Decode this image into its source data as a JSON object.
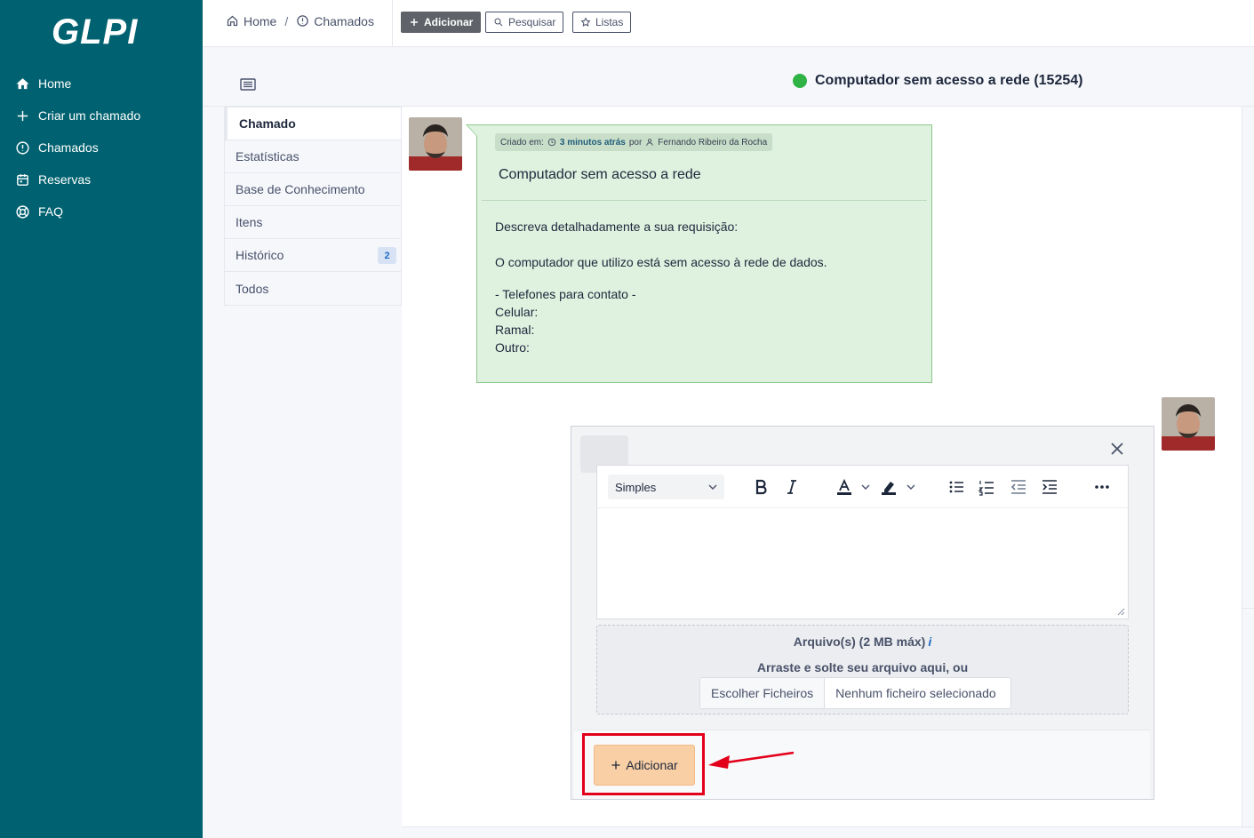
{
  "app": {
    "logo": "GLPI"
  },
  "sidebar": {
    "items": [
      {
        "label": "Home",
        "icon": "home-icon"
      },
      {
        "label": "Criar um chamado",
        "icon": "plus-icon"
      },
      {
        "label": "Chamados",
        "icon": "alert-circle-icon"
      },
      {
        "label": "Reservas",
        "icon": "calendar-icon"
      },
      {
        "label": "FAQ",
        "icon": "lifebuoy-icon"
      }
    ]
  },
  "topbar": {
    "breadcrumb": {
      "home": "Home",
      "separator": "/",
      "current": "Chamados"
    },
    "buttons": {
      "add": "Adicionar",
      "search": "Pesquisar",
      "lists": "Listas"
    }
  },
  "ticket": {
    "title": "Computador sem acesso a rede (15254)",
    "status_color": "#2fb344"
  },
  "tabs": [
    {
      "label": "Chamado",
      "active": true
    },
    {
      "label": "Estatísticas"
    },
    {
      "label": "Base de Conhecimento"
    },
    {
      "label": "Itens"
    },
    {
      "label": "Histórico",
      "badge": "2"
    },
    {
      "label": "Todos"
    }
  ],
  "followup": {
    "meta": {
      "created_label": "Criado em:",
      "time_ago": "3 minutos atrás",
      "by": "por",
      "author": "Fernando Ribeiro da Rocha"
    },
    "title": "Computador sem acesso a rede",
    "body": {
      "line1": "Descreva detalhadamente a sua requisição:",
      "line2": "O computador que utilizo está sem acesso à rede de dados.",
      "line3": "- Telefones para contato -",
      "line4": "Celular:",
      "line5": "Ramal:",
      "line6": "Outro:"
    }
  },
  "form": {
    "format_select": "Simples",
    "upload": {
      "title": "Arquivo(s) (2 MB máx)",
      "info_icon": "i",
      "drop_text": "Arraste e solte seu arquivo aqui, ou",
      "choose_button": "Escolher Ficheiros",
      "no_file": "Nenhum ficheiro selecionado"
    },
    "submit": "Adicionar"
  },
  "colors": {
    "sidebar": "#006270",
    "accent": "#f9cfa5",
    "annotation": "#e3001b"
  }
}
